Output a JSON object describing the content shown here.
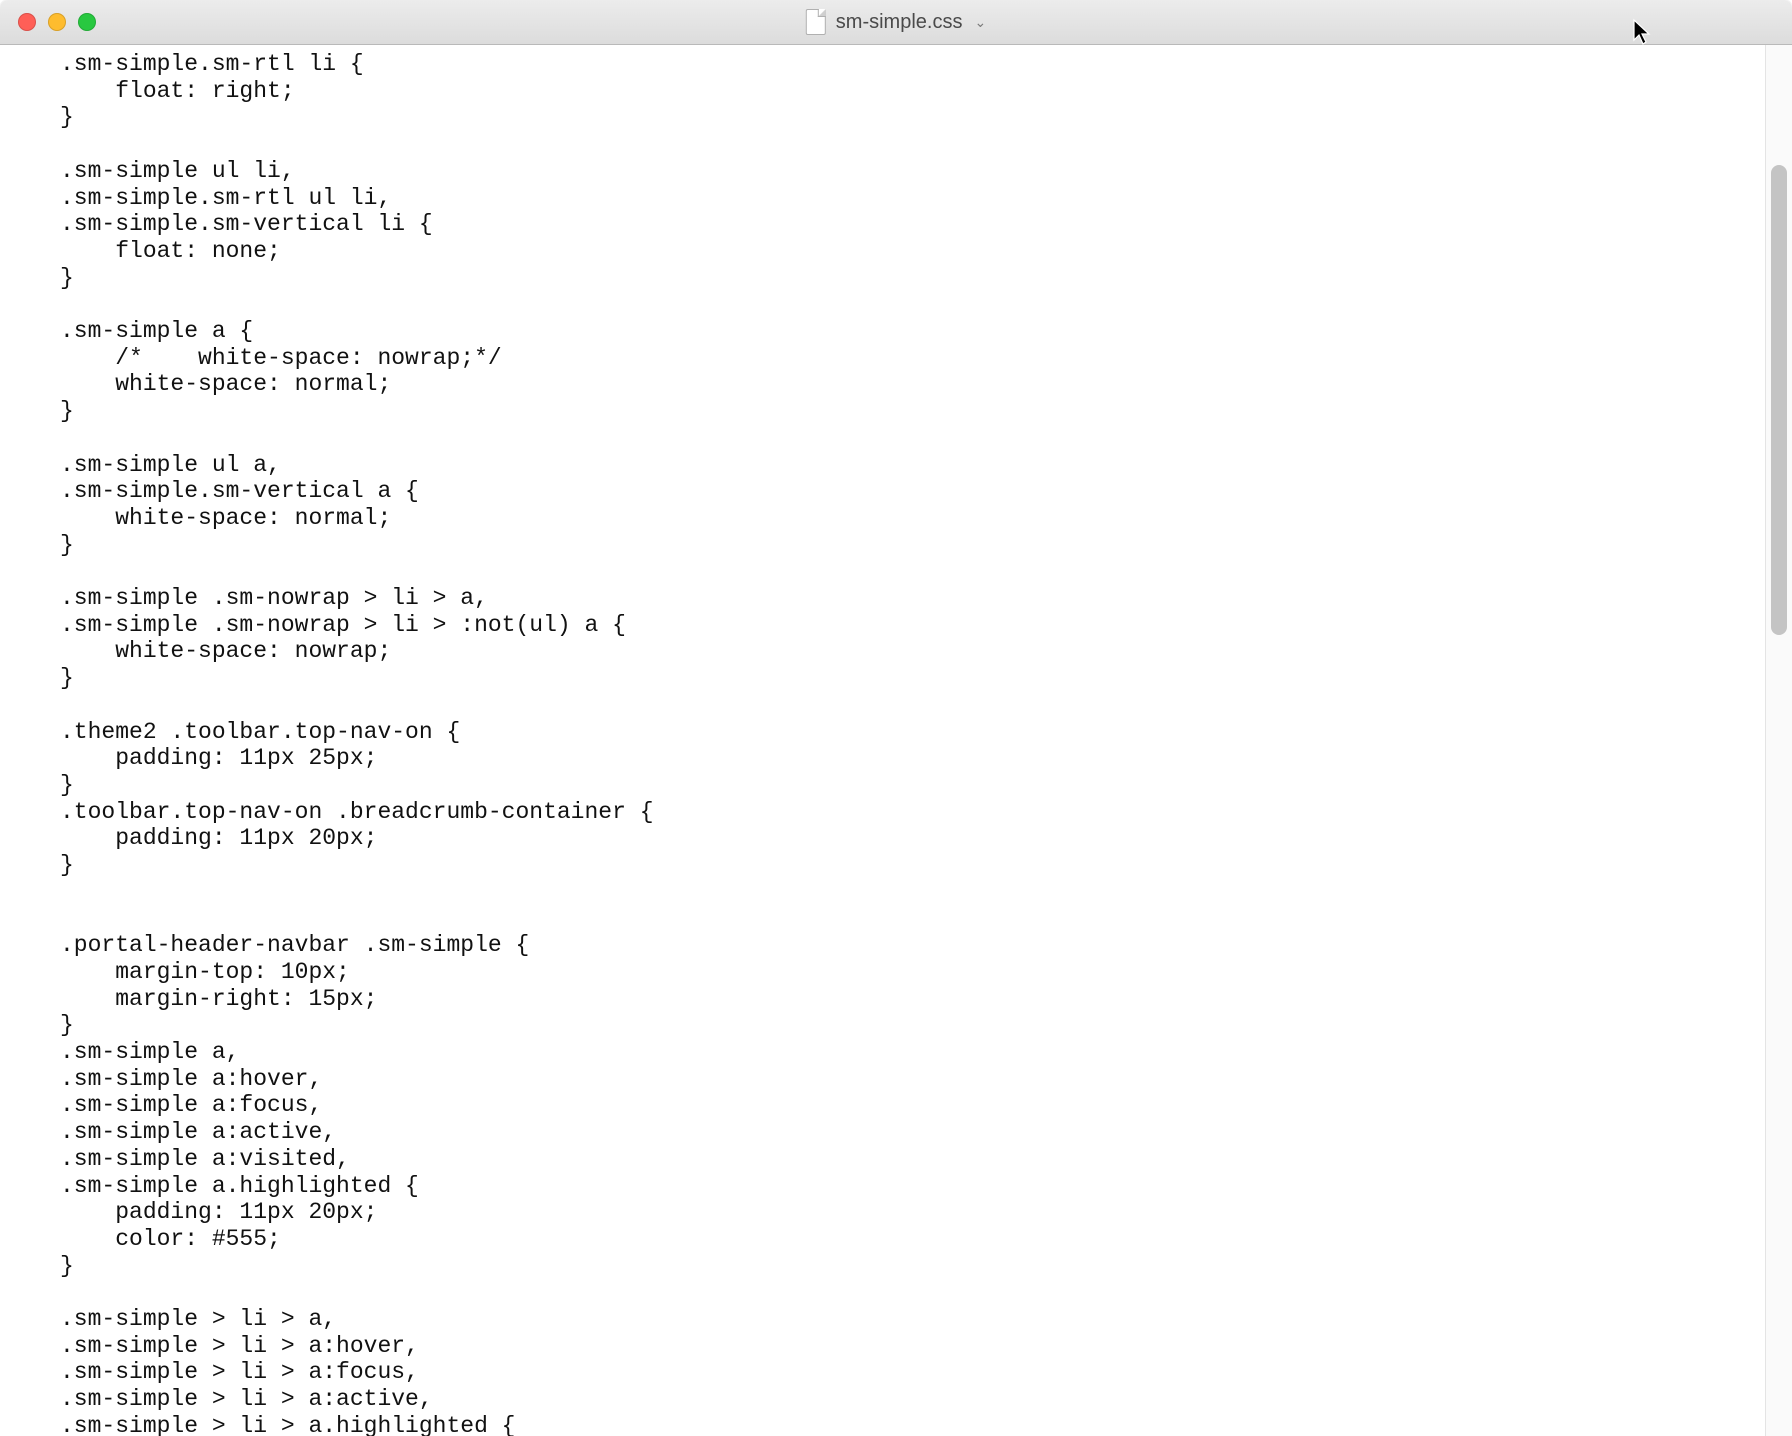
{
  "window": {
    "filename": "sm-simple.css",
    "dropdown_glyph": "⌄"
  },
  "code": ".sm-simple.sm-rtl li {\n    float: right;\n}\n\n.sm-simple ul li,\n.sm-simple.sm-rtl ul li,\n.sm-simple.sm-vertical li {\n    float: none;\n}\n\n.sm-simple a {\n    /*    white-space: nowrap;*/\n    white-space: normal;\n}\n\n.sm-simple ul a,\n.sm-simple.sm-vertical a {\n    white-space: normal;\n}\n\n.sm-simple .sm-nowrap > li > a,\n.sm-simple .sm-nowrap > li > :not(ul) a {\n    white-space: nowrap;\n}\n\n.theme2 .toolbar.top-nav-on {\n    padding: 11px 25px;\n}\n.toolbar.top-nav-on .breadcrumb-container {\n    padding: 11px 20px;\n}\n\n\n.portal-header-navbar .sm-simple {\n    margin-top: 10px;\n    margin-right: 15px;\n}\n.sm-simple a,\n.sm-simple a:hover,\n.sm-simple a:focus,\n.sm-simple a:active,\n.sm-simple a:visited,\n.sm-simple a.highlighted {\n    padding: 11px 20px;\n    color: #555;\n}\n\n.sm-simple > li > a,\n.sm-simple > li > a:hover,\n.sm-simple > li > a:focus,\n.sm-simple > li > a:active,\n.sm-simple > li > a.highlighted {"
}
